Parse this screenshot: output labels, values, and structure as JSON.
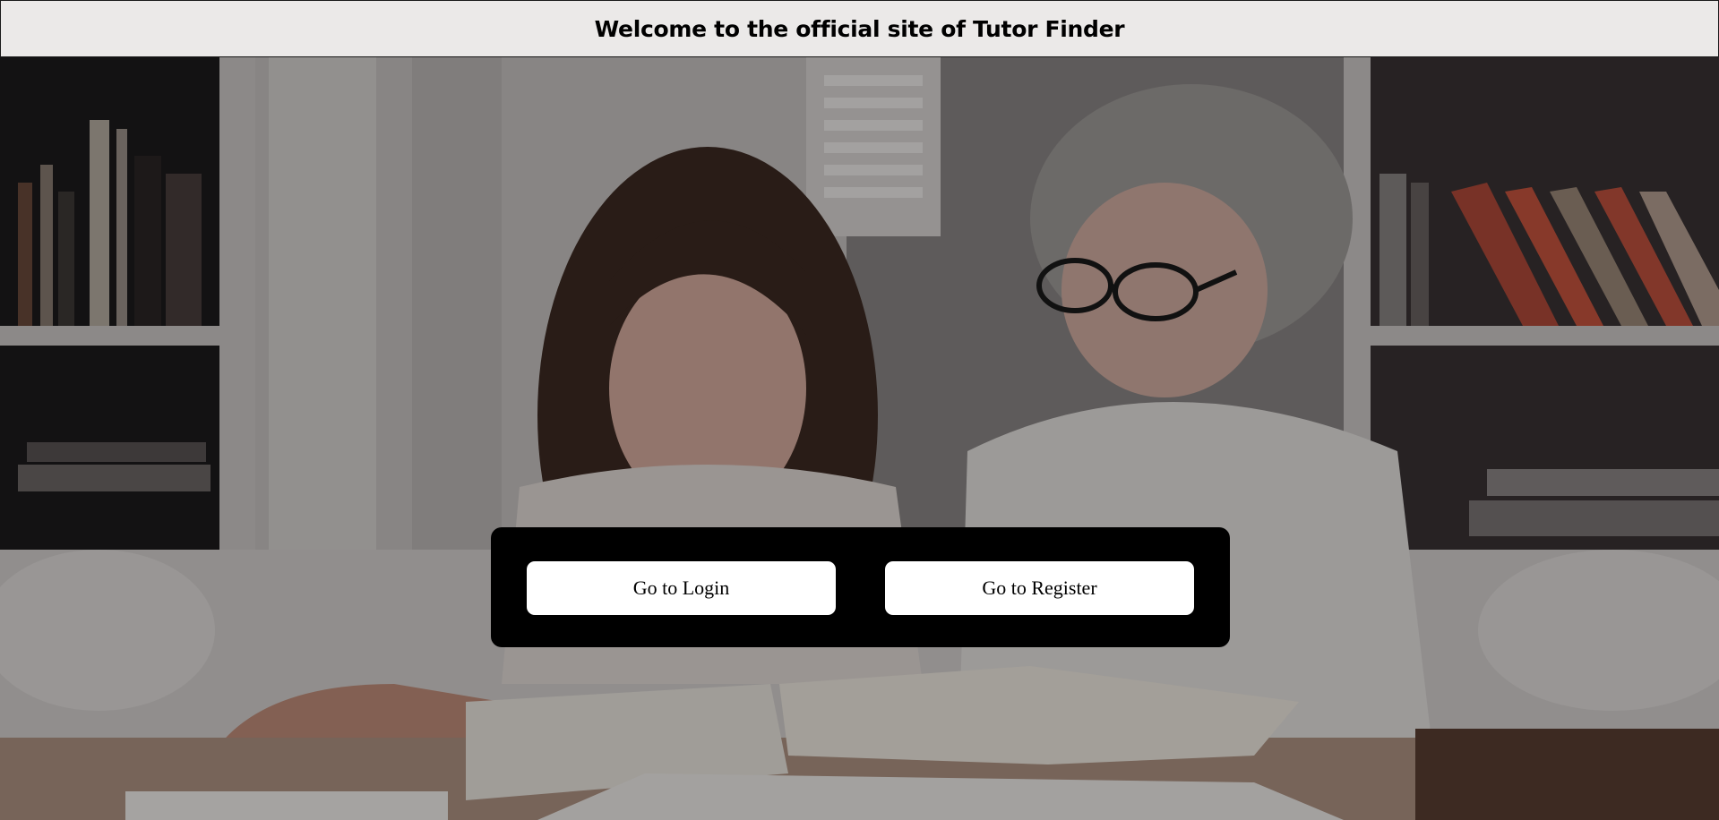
{
  "header": {
    "title": "Welcome to the official site of Tutor Finder"
  },
  "actions": {
    "login_label": "Go to Login",
    "register_label": "Go to Register"
  }
}
